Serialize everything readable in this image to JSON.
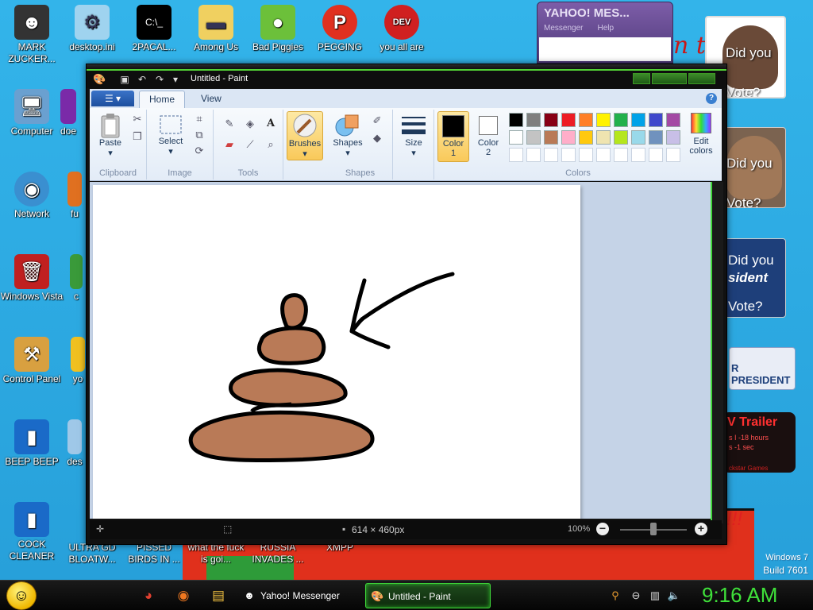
{
  "desktop": {
    "icons": [
      {
        "label": "MARK ZUCKER..."
      },
      {
        "label": "desktop.ini"
      },
      {
        "label": "2PACAL..."
      },
      {
        "label": "Among Us"
      },
      {
        "label": "Bad Piggies"
      },
      {
        "label": "PEGGING"
      },
      {
        "label": "you all are"
      },
      {
        "label": "Computer"
      },
      {
        "label": "doe"
      },
      {
        "label": "Network"
      },
      {
        "label": "fu"
      },
      {
        "label": "Windows Vista"
      },
      {
        "label": "c"
      },
      {
        "label": "Control Panel"
      },
      {
        "label": "yo"
      },
      {
        "label": "BEEP BEEP"
      },
      {
        "label": "des"
      },
      {
        "label": "COCK CLEANER"
      },
      {
        "label": "ULTRA GD BLOATW..."
      },
      {
        "label": "PISSED BIRDS IN ..."
      },
      {
        "label": "what the fuck is goi..."
      },
      {
        "label": "RUSSIA INVADES ..."
      },
      {
        "label": "XMPP"
      }
    ],
    "windows_version": "Windows 7",
    "build": "Build 7601"
  },
  "yahoo_window": {
    "title": "YAHOO! MES...",
    "menu": [
      "Messenger",
      "Help"
    ]
  },
  "ads": {
    "ad1_text": "Did you Vote?",
    "ad2_text": "Did you Vote?",
    "ad3_line1": "Did you",
    "ad3_line2": "sident",
    "ad3_line3": "Vote?",
    "ad4_text": "R PRESIDENT",
    "ad5_title": "V Trailer",
    "ad5_line1": "s I -18 hours",
    "ad5_line2": "s -1 sec",
    "ad5_footer": "ckstar Games",
    "bg_letters": "n t",
    "bg_excl": "!!!"
  },
  "paint": {
    "title": "Untitled - Paint",
    "file_menu_icon": "menu-icon",
    "tabs": {
      "home": "Home",
      "view": "View"
    },
    "groups": {
      "clipboard": "Clipboard",
      "image": "Image",
      "tools": "Tools",
      "shapes": "Shapes",
      "colors": "Colors"
    },
    "buttons": {
      "paste": "Paste",
      "select": "Select",
      "brushes": "Brushes",
      "shapes": "Shapes",
      "size": "Size",
      "color1_line1": "Color",
      "color1_line2": "1",
      "color2_line1": "Color",
      "color2_line2": "2",
      "edit_colors_line1": "Edit",
      "edit_colors_line2": "colors"
    },
    "palette_row1": [
      "#000000",
      "#7f7f7f",
      "#880015",
      "#ed1c24",
      "#ff7f27",
      "#fff200",
      "#22b14c",
      "#00a2e8",
      "#3f48cc",
      "#a349a4"
    ],
    "palette_row2": [
      "#ffffff",
      "#c3c3c3",
      "#b97a57",
      "#ffaec9",
      "#ffc90e",
      "#efe4b0",
      "#b5e61d",
      "#99d9ea",
      "#7092be",
      "#c8bfe7"
    ],
    "color1": "#000000",
    "color2": "#ffffff",
    "drawing_fill": "#b97a57",
    "status": {
      "dimensions": "614 × 460px",
      "zoom": "100%"
    }
  },
  "taskbar": {
    "tasks": [
      {
        "label": "Yahoo! Messenger"
      },
      {
        "label": "Untitled - Paint"
      }
    ],
    "clock": "9:16 AM"
  }
}
